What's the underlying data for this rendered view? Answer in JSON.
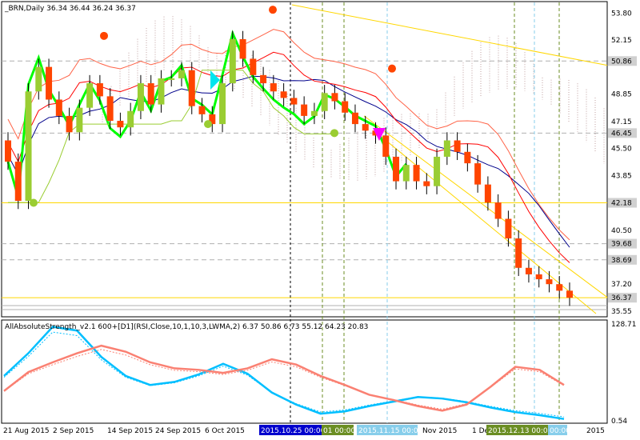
{
  "window": {
    "symbol_header": "_BRN,Daily  36.34 36.44 36.24 36.37",
    "indicator_header": "AllAbsoluteStrength_v2.1 600+[D1](RSI,Close,10,1,10,3,LWMA,2) 6.37 50.86 6.73 55.12 64.23 20.83"
  },
  "colors": {
    "background": "#ffffff",
    "frame": "#000000",
    "bull_candle": "#9acd32",
    "bear_candle": "#ff4500",
    "ichimoku_cloud": "#c0a0a0",
    "kijun": "#9acd32",
    "blue_line": "#00008b",
    "red_line": "#ff0000",
    "green_line": "#00ff00",
    "trend_line": "#ffd700",
    "strength_blue": "#00bfff",
    "strength_red": "#fa8072",
    "date_tag_blue": "#0000cd",
    "date_tag_olive": "#6b8e23",
    "date_tag_lightblue": "#87ceeb"
  },
  "price_axis": {
    "ticks": [
      "53.80",
      "52.15",
      "50.86",
      "48.85",
      "47.15",
      "46.45",
      "45.50",
      "43.85",
      "42.18",
      "40.50",
      "39.68",
      "38.69",
      "37.20",
      "36.37",
      "35.55"
    ],
    "marked_levels": [
      "50.86",
      "46.45",
      "42.18",
      "39.68",
      "38.69",
      "36.37"
    ]
  },
  "indicator_axis": {
    "ticks": [
      "128.71",
      "0.54"
    ]
  },
  "time_axis": {
    "labels": [
      "21 Aug 2015",
      "2 Sep 2015",
      "14 Sep 2015",
      "24 Sep 2015",
      "6 Oct 2015",
      "Nov 2015",
      "1 Dec",
      "2015"
    ],
    "date_tags": [
      "2015.10.25 00:00",
      "01 00:00",
      "2015.11.15 00:00",
      "2015.12.13 00:00",
      "00:00"
    ]
  },
  "chart_data": {
    "type": "candlestick",
    "instrument": "_BRN",
    "timeframe": "Daily",
    "last_ohlc": {
      "open": 36.34,
      "high": 36.44,
      "low": 36.24,
      "close": 36.37
    },
    "y_range": [
      35.3,
      54.4
    ],
    "horizontal_levels": [
      50.86,
      46.45,
      42.18,
      39.68,
      38.69,
      36.37
    ],
    "approx_closes": [
      44.7,
      42.3,
      49.0,
      50.5,
      48.5,
      47.5,
      46.5,
      48.0,
      49.5,
      48.7,
      47.2,
      46.8,
      47.8,
      49.5,
      48.2,
      49.8,
      49.8,
      50.3,
      48.1,
      47.6,
      47.0,
      49.5,
      52.2,
      51.0,
      50.0,
      49.5,
      49.0,
      48.6,
      48.2,
      47.5,
      47.8,
      48.9,
      48.4,
      47.7,
      47.0,
      46.6,
      46.3,
      45.0,
      43.5,
      44.5,
      43.5,
      43.2,
      45.0,
      46.0,
      45.3,
      44.6,
      43.3,
      42.2,
      41.2,
      40.0,
      38.2,
      37.8,
      37.5,
      37.2,
      36.8,
      36.37
    ],
    "indicator": {
      "name": "AllAbsoluteStrength_v2.1",
      "params": "600+[D1](RSI,Close,10,1,10,3,LWMA,2)",
      "values": [
        6.37,
        50.86,
        6.73,
        55.12,
        64.23,
        20.83
      ],
      "y_range": [
        0.54,
        128.71
      ],
      "series": [
        {
          "color": "#00bfff",
          "values": [
            60,
            90,
            125,
            120,
            85,
            60,
            48,
            52,
            62,
            76,
            63,
            38,
            22,
            10,
            13,
            20,
            26,
            32,
            30,
            25,
            18,
            12,
            8,
            3
          ]
        },
        {
          "color": "#fa8072",
          "values": [
            40,
            65,
            78,
            90,
            100,
            92,
            78,
            70,
            68,
            64,
            70,
            82,
            75,
            60,
            48,
            35,
            28,
            20,
            14,
            22,
            46,
            72,
            68,
            48
          ]
        }
      ]
    }
  }
}
